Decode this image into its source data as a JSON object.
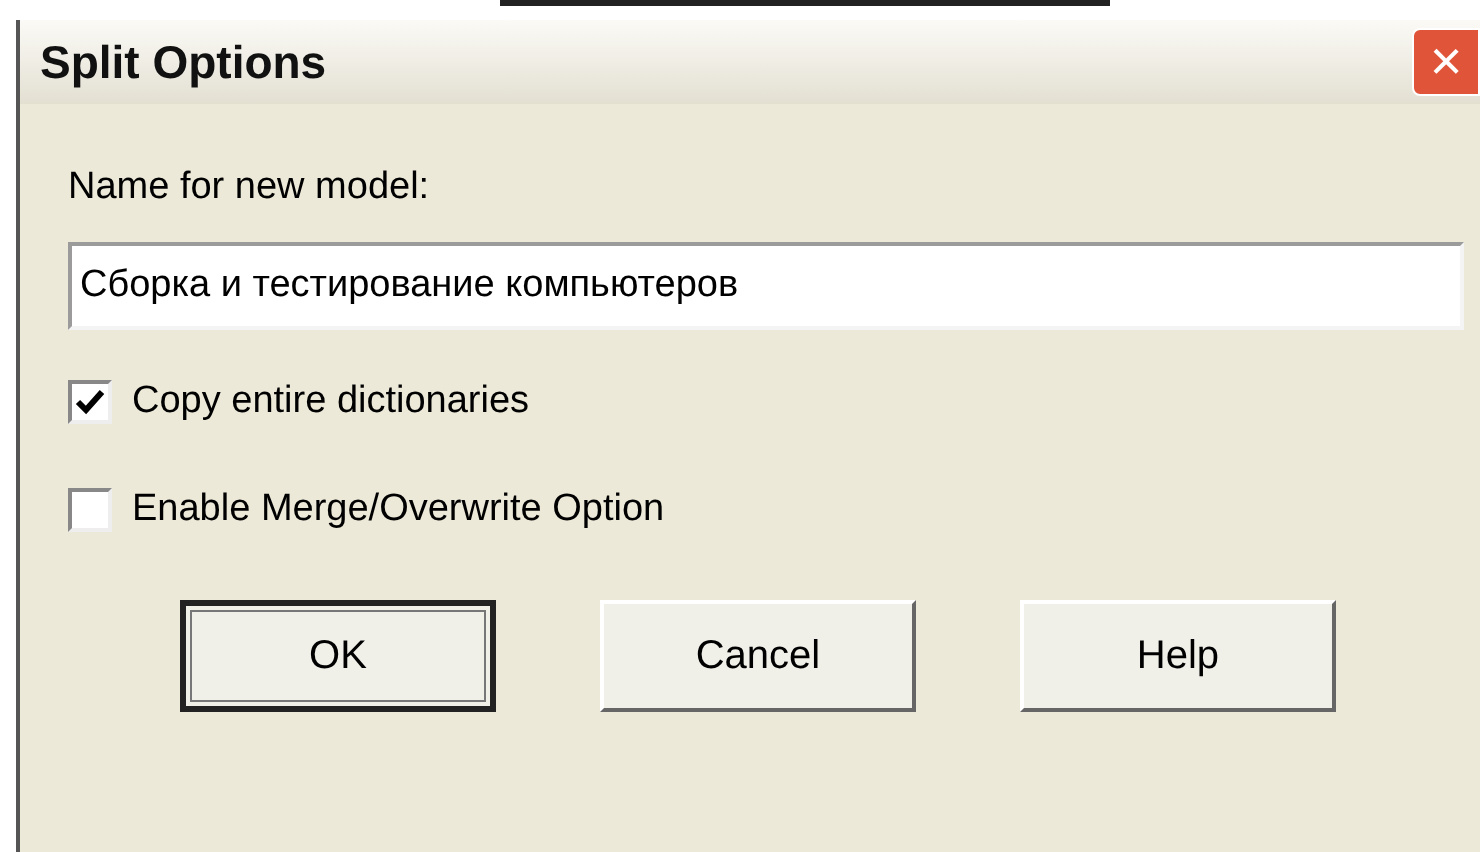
{
  "window": {
    "title": "Split Options",
    "close": "×"
  },
  "name_field": {
    "label": "Name for new model:",
    "value": "Сборка и тестирование компьютеров"
  },
  "options": [
    {
      "label": "Copy entire dictionaries",
      "checked": true
    },
    {
      "label": "Enable Merge/Overwrite Option",
      "checked": false
    }
  ],
  "buttons": [
    {
      "label": "OK",
      "default": true
    },
    {
      "label": "Cancel",
      "default": false
    },
    {
      "label": "Help",
      "default": false
    }
  ]
}
